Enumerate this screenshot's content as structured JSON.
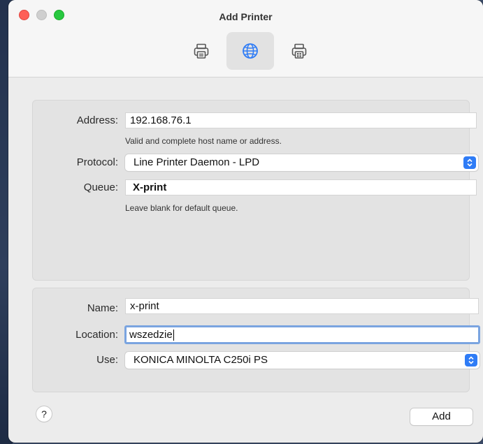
{
  "window": {
    "title": "Add Printer"
  },
  "toolbar": {
    "buttons": [
      {
        "icon": "printer-icon",
        "selected": false
      },
      {
        "icon": "globe-icon",
        "selected": true
      },
      {
        "icon": "windows-printer-icon",
        "selected": false
      }
    ]
  },
  "ip_panel": {
    "address_label": "Address:",
    "address_value": "192.168.76.1",
    "address_hint": "Valid and complete host name or address.",
    "protocol_label": "Protocol:",
    "protocol_value": "Line Printer Daemon - LPD",
    "queue_label": "Queue:",
    "queue_value": "X-print",
    "queue_hint": "Leave blank for default queue."
  },
  "details_panel": {
    "name_label": "Name:",
    "name_value": "x-print",
    "location_label": "Location:",
    "location_value": "wszedzie",
    "use_label": "Use:",
    "use_value": "KONICA MINOLTA C250i PS"
  },
  "footer": {
    "help_label": "?",
    "add_label": "Add"
  },
  "colors": {
    "accent": "#2f7cf6",
    "focus_ring": "#7aa4e0",
    "close": "#fe5f57",
    "zoom": "#28c840"
  }
}
